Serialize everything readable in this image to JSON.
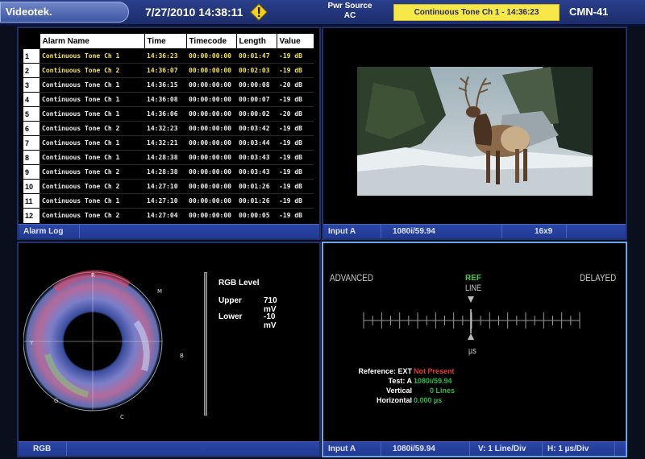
{
  "topbar": {
    "brand": "Videotek.",
    "datetime": "7/27/2010 14:38:11",
    "power_label": "Pwr Source",
    "power_value": "AC",
    "alarm_banner": "Continuous Tone Ch 1 - 14:36:23",
    "device": "CMN-41",
    "warning_color": "#f7d21c"
  },
  "alarm_log": {
    "columns": [
      "Alarm Name",
      "Time",
      "Timecode",
      "Length",
      "Value"
    ],
    "rows": [
      {
        "n": "1",
        "name": "Continuous Tone Ch 1",
        "time": "14:36:23",
        "tc": "00:00:00:00",
        "len": "00:01:47",
        "val": "-19 dB",
        "hl": true
      },
      {
        "n": "2",
        "name": "Continuous Tone Ch 2",
        "time": "14:36:07",
        "tc": "00:00:00:00",
        "len": "00:02:03",
        "val": "-19 dB",
        "hl": true
      },
      {
        "n": "3",
        "name": "Continuous Tone Ch 1",
        "time": "14:36:15",
        "tc": "00:00:00:00",
        "len": "00:00:08",
        "val": "-20 dB",
        "hl": false
      },
      {
        "n": "4",
        "name": "Continuous Tone Ch 1",
        "time": "14:36:08",
        "tc": "00:00:00:00",
        "len": "00:00:07",
        "val": "-19 dB",
        "hl": false
      },
      {
        "n": "5",
        "name": "Continuous Tone Ch 1",
        "time": "14:36:06",
        "tc": "00:00:00:00",
        "len": "00:00:02",
        "val": "-20 dB",
        "hl": false
      },
      {
        "n": "6",
        "name": "Continuous Tone Ch 2",
        "time": "14:32:23",
        "tc": "00:00:00:00",
        "len": "00:03:42",
        "val": "-19 dB",
        "hl": false
      },
      {
        "n": "7",
        "name": "Continuous Tone Ch 1",
        "time": "14:32:21",
        "tc": "00:00:00:00",
        "len": "00:03:44",
        "val": "-19 dB",
        "hl": false
      },
      {
        "n": "8",
        "name": "Continuous Tone Ch 1",
        "time": "14:28:38",
        "tc": "00:00:00:00",
        "len": "00:03:43",
        "val": "-19 dB",
        "hl": false
      },
      {
        "n": "9",
        "name": "Continuous Tone Ch 2",
        "time": "14:28:38",
        "tc": "00:00:00:00",
        "len": "00:03:43",
        "val": "-19 dB",
        "hl": false
      },
      {
        "n": "10",
        "name": "Continuous Tone Ch 2",
        "time": "14:27:10",
        "tc": "00:00:00:00",
        "len": "00:01:26",
        "val": "-19 dB",
        "hl": false
      },
      {
        "n": "11",
        "name": "Continuous Tone Ch 1",
        "time": "14:27:10",
        "tc": "00:00:00:00",
        "len": "00:01:26",
        "val": "-19 dB",
        "hl": false
      },
      {
        "n": "12",
        "name": "Continuous Tone Ch 2",
        "time": "14:27:04",
        "tc": "00:00:00:00",
        "len": "00:00:05",
        "val": "-19 dB",
        "hl": false
      }
    ],
    "status": "Alarm Log"
  },
  "picture": {
    "status_input": "Input A",
    "status_format": "1080i/59.94",
    "status_aspect": "16x9"
  },
  "vector": {
    "labels": {
      "r": "R",
      "mg": "M",
      "b": "B",
      "cy": "C",
      "g": "G",
      "yl": "Y"
    },
    "rgb_title": "RGB Level",
    "upper_label": "Upper",
    "upper_value": "710 mV",
    "lower_label": "Lower",
    "lower_value": "-10 mV",
    "status": "RGB"
  },
  "timing": {
    "advanced": "ADVANCED",
    "delayed": "DELAYED",
    "ref": "REF",
    "line": "LINE",
    "us": "µs",
    "reference_label": "Reference: EXT",
    "reference_value": "Not Present",
    "test_label": "Test: A",
    "test_value": "1080i/59.94",
    "vertical_label": "Vertical",
    "vertical_value": "0 Lines",
    "horizontal_label": "Horizontal",
    "horizontal_value": "0.000 µs",
    "colors": {
      "ref_green": "#3ccf3c",
      "not_present": "#e23a3a",
      "value_green": "#2fb84a"
    },
    "status_input": "Input A",
    "status_format": "1080i/59.94",
    "status_v": "V: 1 Line/Div",
    "status_h": "H: 1 µs/Div"
  }
}
